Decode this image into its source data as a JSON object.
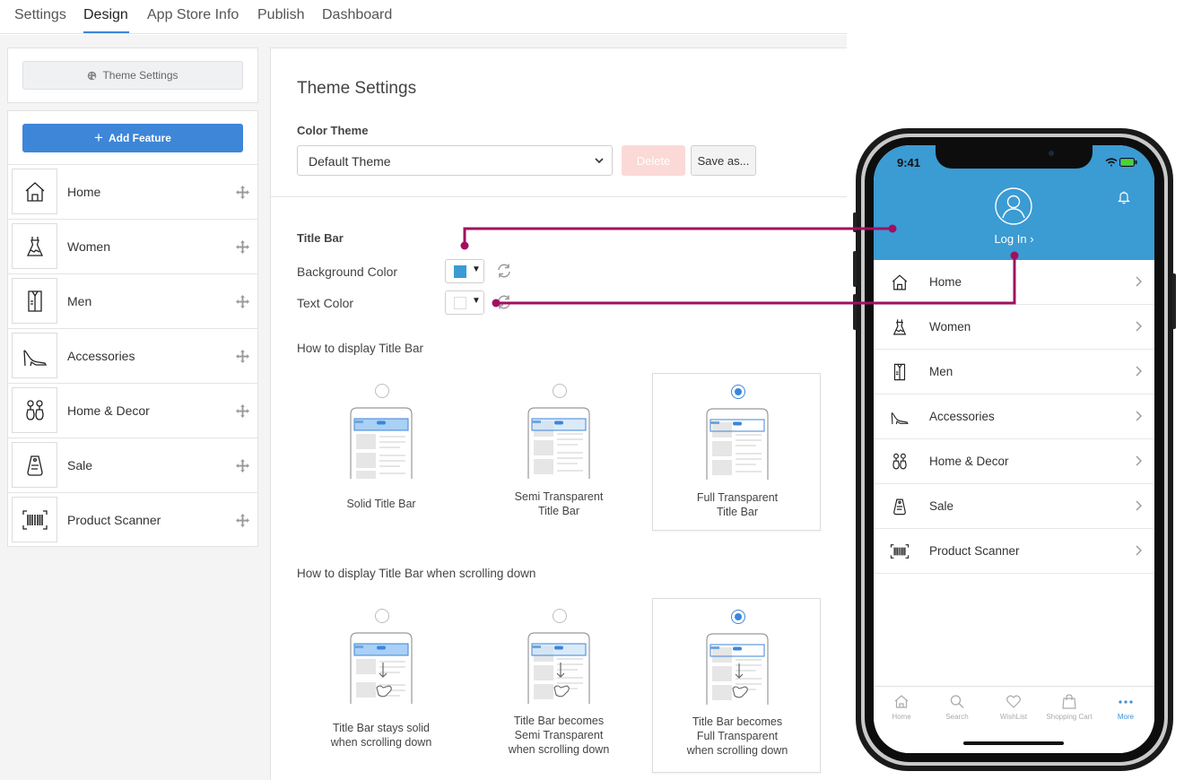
{
  "nav": {
    "tabs": [
      "Settings",
      "Design",
      "App Store Info",
      "Publish",
      "Dashboard"
    ],
    "active": "Design"
  },
  "sidebar": {
    "theme_settings_label": "Theme Settings",
    "add_feature_label": "Add Feature",
    "features": [
      {
        "label": "Home",
        "icon": "house-icon"
      },
      {
        "label": "Women",
        "icon": "dress-icon"
      },
      {
        "label": "Men",
        "icon": "shirt-icon"
      },
      {
        "label": "Accessories",
        "icon": "high-heel-icon"
      },
      {
        "label": "Home & Decor",
        "icon": "vase-icon"
      },
      {
        "label": "Sale",
        "icon": "sale-tag-icon"
      },
      {
        "label": "Product Scanner",
        "icon": "barcode-icon"
      }
    ]
  },
  "main": {
    "title": "Theme Settings",
    "color_theme_label": "Color Theme",
    "color_theme_value": "Default Theme",
    "delete_label": "Delete",
    "save_as_label": "Save as...",
    "title_bar_label": "Title Bar",
    "background_color_label": "Background Color",
    "background_color": "#3b9bd3",
    "text_color_label": "Text Color",
    "text_color": "#ffffff",
    "display_heading": "How to display Title Bar",
    "display_options": [
      {
        "lines": [
          "Solid Title Bar"
        ],
        "selected": false
      },
      {
        "lines": [
          "Semi Transparent",
          "Title Bar"
        ],
        "selected": false
      },
      {
        "lines": [
          "Full Transparent",
          "Title Bar"
        ],
        "selected": true
      }
    ],
    "scroll_heading": "How to display Title Bar when scrolling down",
    "scroll_options": [
      {
        "lines": [
          "Title Bar stays solid",
          "when scrolling down"
        ],
        "selected": false
      },
      {
        "lines": [
          "Title Bar becomes",
          "Semi Transparent",
          "when scrolling down"
        ],
        "selected": false
      },
      {
        "lines": [
          "Title Bar becomes",
          "Full Transparent",
          "when scrolling down"
        ],
        "selected": true
      }
    ]
  },
  "phone": {
    "time": "9:41",
    "login_label": "Log In ›",
    "menu": [
      "Home",
      "Women",
      "Men",
      "Accessories",
      "Home & Decor",
      "Sale",
      "Product Scanner"
    ],
    "tabbar": [
      "Home",
      "Search",
      "WishList",
      "Shopping Cart",
      "More"
    ],
    "active_tab": "More"
  },
  "colors": {
    "accent": "#3d86d8",
    "connector": "#a0105f",
    "title_bar": "#3b9bd3"
  }
}
